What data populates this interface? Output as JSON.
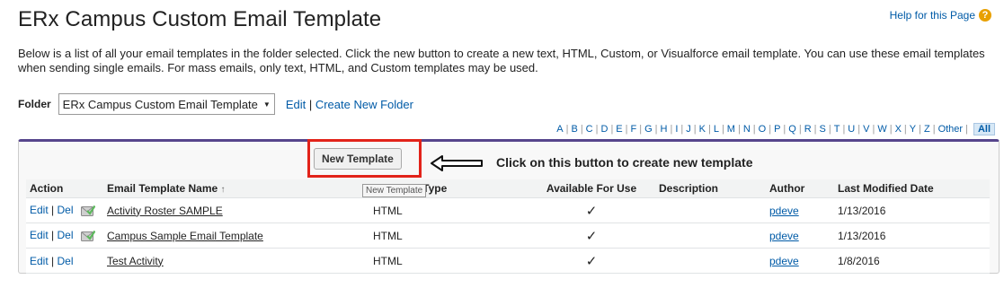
{
  "page": {
    "title": "ERx Campus Custom Email Template",
    "help_label": "Help for this Page",
    "description": "Below is a list of all your email templates in the folder selected. Click the new button to create a new text, HTML, Custom, or Visualforce email template. You can use these email templates when sending single emails. For mass emails, only text, HTML, and Custom templates may be used."
  },
  "folder": {
    "label": "Folder",
    "selected": "ERx Campus Custom Email Template",
    "edit_label": "Edit",
    "create_label": "Create New Folder"
  },
  "alphabet": [
    "A",
    "B",
    "C",
    "D",
    "E",
    "F",
    "G",
    "H",
    "I",
    "J",
    "K",
    "L",
    "M",
    "N",
    "O",
    "P",
    "Q",
    "R",
    "S",
    "T",
    "U",
    "V",
    "W",
    "X",
    "Y",
    "Z",
    "Other"
  ],
  "alphabet_all": "All",
  "toolbar": {
    "new_template_label": "New Template",
    "tooltip": "New Template"
  },
  "annotation": "Click on this button to create new template",
  "table": {
    "headers": [
      "Action",
      "Email Template Name",
      "Template Type",
      "Available For Use",
      "Description",
      "Author",
      "Last Modified Date"
    ],
    "sort_indicator": "↑",
    "edit_label": "Edit",
    "del_label": "Del",
    "rows": [
      {
        "name": "Activity Roster SAMPLE",
        "type": "HTML",
        "available": "✓",
        "description": "",
        "author": "pdeve",
        "modified": "1/13/2016"
      },
      {
        "name": "Campus Sample Email Template",
        "type": "HTML",
        "available": "✓",
        "description": "",
        "author": "pdeve",
        "modified": "1/13/2016"
      },
      {
        "name": "Test Activity",
        "type": "HTML",
        "available": "✓",
        "description": "",
        "author": "pdeve",
        "modified": "1/8/2016"
      }
    ]
  },
  "colors": {
    "link": "#015ba7",
    "highlight": "#e2231a",
    "panel_top": "#56458c"
  }
}
